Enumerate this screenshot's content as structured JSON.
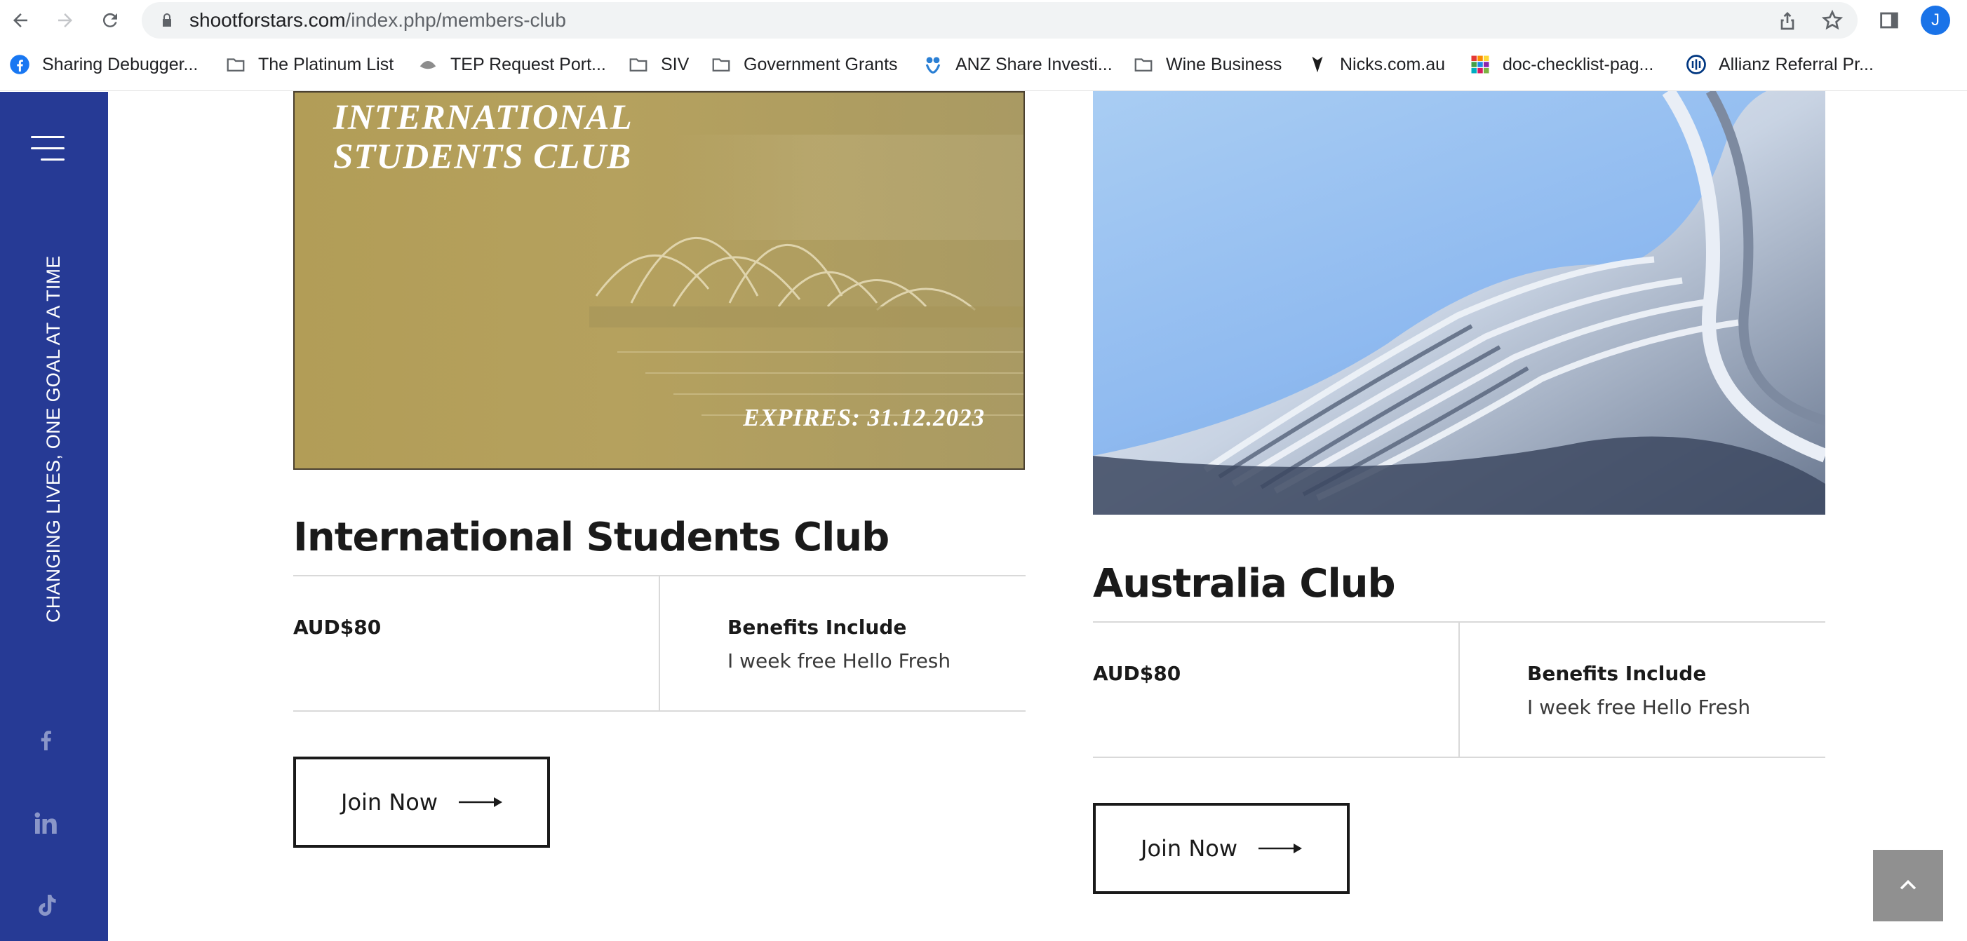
{
  "browser": {
    "url_domain": "shootforstars.com",
    "url_path": "/index.php/members-club",
    "profile_initial": "J",
    "bookmarks": [
      {
        "label": "Sharing Debugger...",
        "icon": "facebook-icon"
      },
      {
        "label": "The Platinum List",
        "icon": "folder-icon"
      },
      {
        "label": "TEP Request Port...",
        "icon": "crest-icon"
      },
      {
        "label": "SIV",
        "icon": "folder-icon"
      },
      {
        "label": "Government Grants",
        "icon": "folder-icon"
      },
      {
        "label": "ANZ Share Investi...",
        "icon": "anz-icon"
      },
      {
        "label": "Wine Business",
        "icon": "folder-icon"
      },
      {
        "label": "Nicks.com.au",
        "icon": "nicks-icon"
      },
      {
        "label": "doc-checklist-pag...",
        "icon": "grid-color-icon"
      },
      {
        "label": "Allianz Referral Pr...",
        "icon": "allianz-icon"
      }
    ]
  },
  "sidebar": {
    "tagline": "CHANGING LIVES, ONE GOAL AT A TIME",
    "socials": [
      "facebook-icon",
      "linkedin-icon",
      "tiktok-icon"
    ]
  },
  "clubs": [
    {
      "image_title_line1": "INTERNATIONAL",
      "image_title_line2": "STUDENTS CLUB",
      "image_expiry": "EXPIRES: 31.12.2023",
      "title": "International Students Club",
      "price": "AUD$80",
      "benefits_heading": "Benefits Include",
      "benefits_text": "I week free Hello Fresh",
      "button_label": "Join Now"
    },
    {
      "title": "Australia Club",
      "price": "AUD$80",
      "benefits_heading": "Benefits Include",
      "benefits_text": "I week free Hello Fresh",
      "button_label": "Join Now"
    }
  ],
  "colors": {
    "sidebar": "#263a95",
    "gold_card": "#b29d57",
    "back_to_top": "#909090"
  }
}
